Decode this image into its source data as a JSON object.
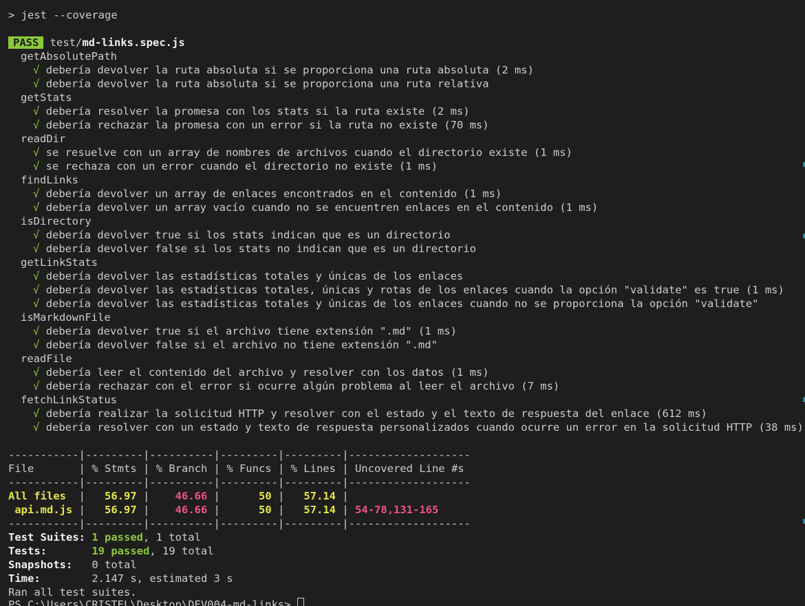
{
  "command": {
    "prompt": ">",
    "text": "jest --coverage"
  },
  "suite": {
    "status": "PASS",
    "path_dir": "test/",
    "path_file": "md-links.spec.js"
  },
  "groups": [
    {
      "name": "getAbsolutePath",
      "tests": [
        "debería devolver la ruta absoluta si se proporciona una ruta absoluta (2 ms)",
        "debería devolver la ruta absoluta si se proporciona una ruta relativa"
      ]
    },
    {
      "name": "getStats",
      "tests": [
        "debería resolver la promesa con los stats si la ruta existe (2 ms)",
        "debería rechazar la promesa con un error si la ruta no existe (70 ms)"
      ]
    },
    {
      "name": "readDir",
      "tests": [
        "se resuelve con un array de nombres de archivos cuando el directorio existe (1 ms)",
        "se rechaza con un error cuando el directorio no existe (1 ms)"
      ]
    },
    {
      "name": "findLinks",
      "tests": [
        "debería devolver un array de enlaces encontrados en el contenido (1 ms)",
        "debería devolver un array vacío cuando no se encuentren enlaces en el contenido (1 ms)"
      ]
    },
    {
      "name": "isDirectory",
      "tests": [
        "debería devolver true si los stats indican que es un directorio",
        "debería devolver false si los stats no indican que es un directorio"
      ]
    },
    {
      "name": "getLinkStats",
      "tests": [
        "debería devolver las estadísticas totales y únicas de los enlaces",
        "debería devolver las estadísticas totales, únicas y rotas de los enlaces cuando la opción \"validate\" es true (1 ms)",
        "debería devolver las estadísticas totales y únicas de los enlaces cuando no se proporciona la opción \"validate\""
      ]
    },
    {
      "name": "isMarkdownFile",
      "tests": [
        "debería devolver true si el archivo tiene extensión \".md\" (1 ms)",
        "debería devolver false si el archivo no tiene extensión \".md\""
      ]
    },
    {
      "name": "readFile",
      "tests": [
        "debería leer el contenido del archivo y resolver con los datos (1 ms)",
        "debería rechazar con el error si ocurre algún problema al leer el archivo (7 ms)"
      ]
    },
    {
      "name": "fetchLinkStatus",
      "tests": [
        "debería realizar la solicitud HTTP y resolver con el estado y el texto de respuesta del enlace (612 ms)",
        "debería resolver con un estado y texto de respuesta personalizados cuando ocurre un error en la solicitud HTTP (38 ms)"
      ]
    }
  ],
  "check_mark": "√",
  "coverage": {
    "separator": "-----------|---------|----------|---------|---------|-------------------",
    "headers": [
      "File",
      "% Stmts",
      "% Branch",
      "% Funcs",
      "% Lines",
      "Uncovered Line #s"
    ],
    "rows": [
      {
        "file": "All files",
        "stmts": "56.97",
        "branch": "46.66",
        "funcs": "50",
        "lines": "57.14",
        "uncovered": ""
      },
      {
        "file": " api.md.js",
        "stmts": "56.97",
        "branch": "46.66",
        "funcs": "50",
        "lines": "57.14",
        "uncovered": "54-78,131-165"
      }
    ]
  },
  "summary": {
    "suites_label": "Test Suites:",
    "suites_passed": "1 passed",
    "suites_total": ", 1 total",
    "tests_label": "Tests:",
    "tests_passed": "19 passed",
    "tests_total": ", 19 total",
    "snapshots_label": "Snapshots:",
    "snapshots_value": "0 total",
    "time_label": "Time:",
    "time_value": "2.147 s, estimated 3 s",
    "ran_all": "Ran all test suites."
  },
  "next_prompt": "PS C:\\Users\\CRISTEL\\Desktop\\DEV004-md-links> ",
  "colors": {
    "pass_badge": "#8cc83c",
    "yellow": "#e5e54a",
    "red": "#f0508c",
    "green": "#8cc83c",
    "scroll_marker": "#1f8ea6"
  }
}
